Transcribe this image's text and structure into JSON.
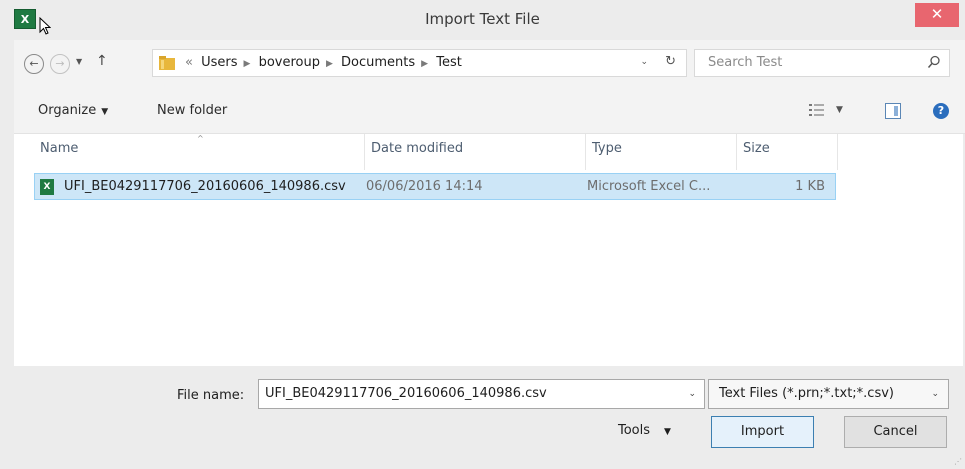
{
  "titlebar": {
    "app_icon": "excel-icon",
    "app_icon_text": "X",
    "title": "Import Text File",
    "close_glyph": "✕"
  },
  "nav": {
    "back_glyph": "←",
    "forward_glyph": "→",
    "recent_glyph": "▼",
    "up_glyph": "↑",
    "breadcrumb_prefix": "«",
    "breadcrumbs": [
      "Users",
      "boveroup",
      "Documents",
      "Test"
    ],
    "dropdown_glyph": "⌄",
    "refresh_glyph": "↻",
    "search_placeholder": "Search Test"
  },
  "toolbar": {
    "organize": "Organize",
    "new_folder": "New folder",
    "caret": "▼",
    "help_glyph": "?"
  },
  "filelist": {
    "columns": [
      "Name",
      "Date modified",
      "Type",
      "Size"
    ],
    "sort_glyph": "^",
    "rows": [
      {
        "name": "UFI_BE0429117706_20160606_140986.csv",
        "date": "06/06/2016 14:14",
        "type": "Microsoft Excel C...",
        "size": "1 KB",
        "icon_text": "X",
        "selected": true
      }
    ]
  },
  "footer": {
    "file_name_label": "File name:",
    "file_name_value": "UFI_BE0429117706_20160606_140986.csv",
    "file_type_value": "Text Files (*.prn;*.txt;*.csv)",
    "tools_label": "Tools",
    "import_label": "Import",
    "cancel_label": "Cancel",
    "dropdown_glyph": "⌄"
  },
  "colors": {
    "selection_fill": "#cde6f7",
    "selection_border": "#99d1f4",
    "close_button": "#e8666f",
    "excel_green": "#1f7a42",
    "primary_button_border": "#3c7fb1"
  }
}
